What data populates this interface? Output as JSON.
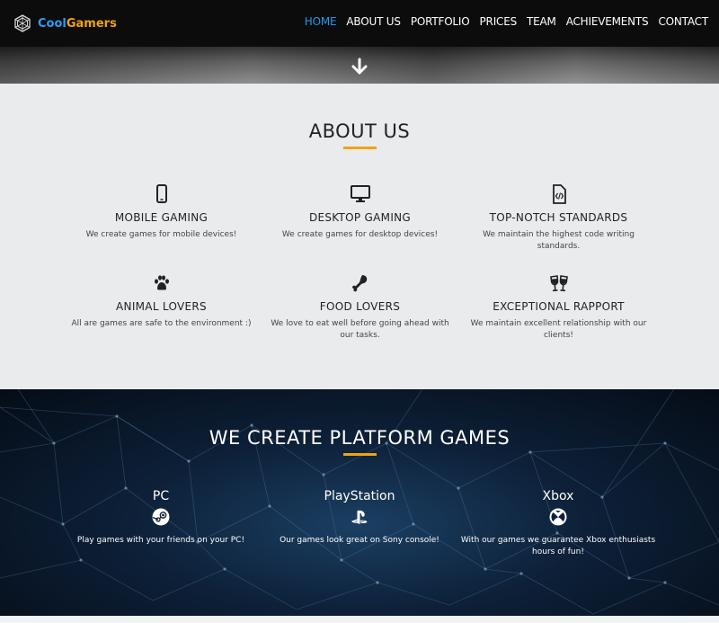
{
  "brand": {
    "part1": "Cool",
    "part2": "Gamers",
    "icon": "logo-icon"
  },
  "nav": {
    "items": [
      {
        "label": "HOME",
        "active": true
      },
      {
        "label": "ABOUT US",
        "active": false
      },
      {
        "label": "PORTFOLIO",
        "active": false
      },
      {
        "label": "PRICES",
        "active": false
      },
      {
        "label": "TEAM",
        "active": false
      },
      {
        "label": "ACHIEVEMENTS",
        "active": false
      },
      {
        "label": "CONTACT",
        "active": false
      }
    ],
    "active_color": "#1f9bf0"
  },
  "hero": {
    "arrow_icon": "arrow-down-icon"
  },
  "about": {
    "title": "ABOUT US",
    "accent": "#f2a20f",
    "features": [
      {
        "icon": "mobile-icon",
        "name": "MOBILE GAMING",
        "desc": "We create games for mobile devices!"
      },
      {
        "icon": "desktop-icon",
        "name": "DESKTOP GAMING",
        "desc": "We create games for desktop devices!"
      },
      {
        "icon": "code-file-icon",
        "name": "TOP-NOTCH STANDARDS",
        "desc": "We maintain the highest code writing standards."
      },
      {
        "icon": "paw-icon",
        "name": "ANIMAL LOVERS",
        "desc": "All are games are safe to the environment :)"
      },
      {
        "icon": "food-icon",
        "name": "FOOD LOVERS",
        "desc": "We love to eat well before going ahead with our tasks."
      },
      {
        "icon": "glasses-cheers-icon",
        "name": "EXCEPTIONAL RAPPORT",
        "desc": "We maintain excellent relationship with our clients!"
      }
    ]
  },
  "platforms": {
    "title": "WE CREATE PLATFORM GAMES",
    "items": [
      {
        "icon": "steam-icon",
        "name": "PC",
        "desc": "Play games with your friends on your PC!"
      },
      {
        "icon": "playstation-icon",
        "name": "PlayStation",
        "desc": "Our games look great on Sony console!"
      },
      {
        "icon": "xbox-icon",
        "name": "Xbox",
        "desc": "With our games we guarantee Xbox enthusiasts hours of fun!"
      }
    ]
  }
}
